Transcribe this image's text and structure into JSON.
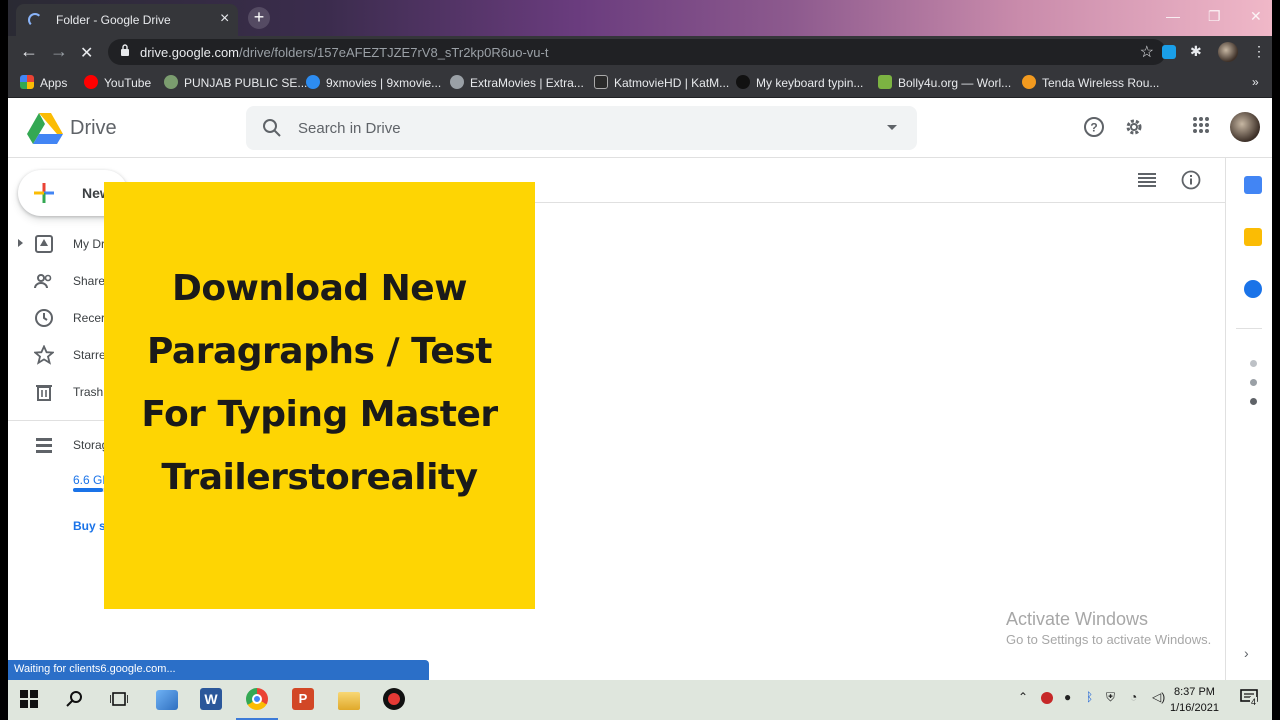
{
  "browser": {
    "tab_title": "Folder - Google Drive",
    "url_host": "drive.google.com",
    "url_path": "/drive/folders/157eAFEZTJZE7rV8_sTr2kp0R6uo-vu-t",
    "bookmarks": [
      "Apps",
      "YouTube",
      "PUNJAB PUBLIC SE...",
      "9xmovies | 9xmovie...",
      "ExtraMovies | Extra...",
      "KatmovieHD | KatM...",
      "My keyboard typin...",
      "Bolly4u.org — Worl...",
      "Tenda Wireless Rou..."
    ],
    "status_text": "Waiting for clients6.google.com..."
  },
  "drive": {
    "logo_text": "Drive",
    "search_placeholder": "Search in Drive",
    "new_label": "New",
    "nav": [
      {
        "label": "My Dr",
        "icon": "my-drive-icon"
      },
      {
        "label": "Share",
        "icon": "shared-icon"
      },
      {
        "label": "Recer",
        "icon": "recent-icon"
      },
      {
        "label": "Starre",
        "icon": "star-icon"
      },
      {
        "label": "Trash",
        "icon": "trash-icon"
      }
    ],
    "storage_label": "Storag",
    "storage_used": "6.6 GE",
    "buy_label": "Buy s"
  },
  "overlay": {
    "lines": [
      "Download New",
      "Paragraphs / Test",
      "For Typing Master",
      "Trailerstoreality"
    ]
  },
  "watermark": {
    "title": "Activate Windows",
    "subtitle": "Go to Settings to activate Windows."
  },
  "taskbar": {
    "time": "8:37 PM",
    "date": "1/16/2021",
    "notification_count": "4"
  },
  "colors": {
    "accent": "#1a73e8",
    "overlay_bg": "#fed503",
    "chrome_dark": "#35363a"
  }
}
